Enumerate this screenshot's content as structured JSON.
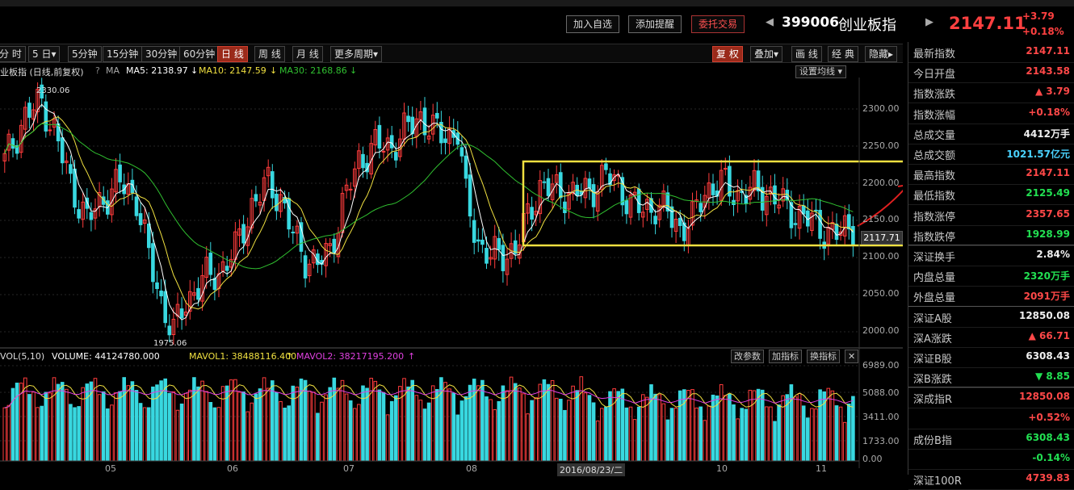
{
  "header": {
    "buttons": [
      "加入自选",
      "添加提醒",
      "委托交易"
    ],
    "code": "399006",
    "name": "创业板指",
    "price": "2147.11",
    "change": "+3.79",
    "change_pct": "+0.18%"
  },
  "toolbar": {
    "left": [
      "分 时",
      "5 日",
      "5分钟",
      "15分钟",
      "30分钟",
      "60分钟",
      "日 线",
      "周 线",
      "月 线",
      "更多周期"
    ],
    "active_left": "日 线",
    "right": [
      "复 权",
      "叠加",
      "画 线",
      "经 典",
      "隐藏"
    ],
    "active_right": "复 权"
  },
  "legend": {
    "title": "业板指 (日线,前复权)",
    "help": "?",
    "ma_label": "MA",
    "ma5": "MA5: 2138.97",
    "ma10": "MA10: 2147.59",
    "ma30": "MA30: 2168.86",
    "setting": "设置均线"
  },
  "price_axis": [
    "2300.00",
    "2250.00",
    "2200.00",
    "2150.00",
    "2100.00",
    "2050.00",
    "2000.00"
  ],
  "annotations": {
    "high": "2330.06",
    "low": "1975.06",
    "last": "2117.71"
  },
  "volume_legend": {
    "vol": "VOL(5,10)",
    "volume": "VOLUME: 44124780.000",
    "mavol1": "MAVOL1: 38488116.400",
    "mavol2": "MAVOL2: 38217195.200",
    "buttons": [
      "改参数",
      "加指标",
      "换指标"
    ]
  },
  "volume_axis": [
    "6989.00",
    "5088.00",
    "3411.00",
    "1733.00",
    "0.00"
  ],
  "x_axis": [
    "05",
    "06",
    "07",
    "08",
    "2016/08/23/二",
    "10",
    "11"
  ],
  "quote": [
    {
      "label": "最新指数",
      "value": "2147.11",
      "color": "red"
    },
    {
      "label": "今日开盘",
      "value": "2143.58",
      "color": "red"
    },
    {
      "label": "指数涨跌",
      "value": "3.79",
      "color": "red",
      "icon": "▲"
    },
    {
      "label": "指数涨幅",
      "value": "+0.18%",
      "color": "red"
    },
    {
      "label": "总成交量",
      "value": "4412万手",
      "color": "white"
    },
    {
      "label": "总成交额",
      "value": "1021.57亿元",
      "color": "cyan"
    },
    {
      "label": "最高指数",
      "value": "2147.11",
      "color": "red"
    },
    {
      "label": "最低指数",
      "value": "2125.49",
      "color": "green"
    },
    {
      "label": "指数涨停",
      "value": "2357.65",
      "color": "red"
    },
    {
      "label": "指数跌停",
      "value": "1928.99",
      "color": "green"
    },
    {
      "label": "深证换手",
      "value": "2.84%",
      "color": "white"
    },
    {
      "label": "内盘总量",
      "value": "2320万手",
      "color": "green"
    },
    {
      "label": "外盘总量",
      "value": "2091万手",
      "color": "red"
    },
    {
      "label": "深证A股",
      "value": "12850.08",
      "color": "white"
    },
    {
      "label": "深A涨跌",
      "value": "66.71",
      "color": "red",
      "icon": "▲"
    },
    {
      "label": "深证B股",
      "value": "6308.43",
      "color": "white"
    },
    {
      "label": "深B涨跌",
      "value": "8.85",
      "color": "green",
      "icon": "▼"
    },
    {
      "label": "深成指R",
      "value": "12850.08",
      "color": "red"
    },
    {
      "label": "",
      "value": "+0.52%",
      "color": "red"
    },
    {
      "label": "成份B指",
      "value": "6308.43",
      "color": "green"
    },
    {
      "label": "",
      "value": "-0.14%",
      "color": "green"
    },
    {
      "label": "深证100R",
      "value": "4739.83",
      "color": "red"
    }
  ],
  "colors": {
    "up": "#ff3c3c",
    "down": "#38d8e0",
    "ma5": "#ffffff",
    "ma10": "#f0e040",
    "ma30": "#30c030",
    "box": "#f0e040"
  }
}
